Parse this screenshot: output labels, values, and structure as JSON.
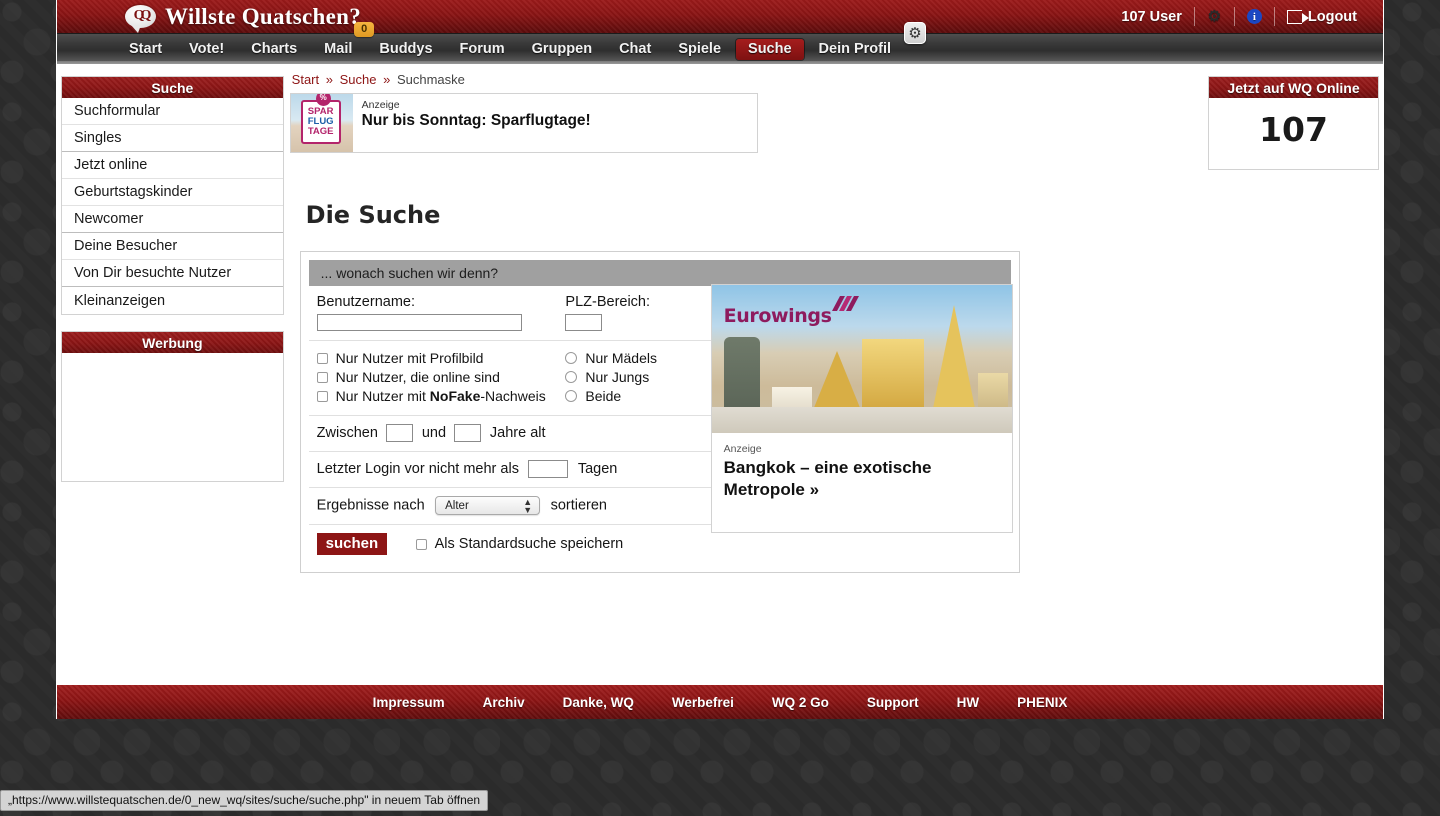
{
  "header": {
    "logo_text": "Willste Quatschen?",
    "logo_icon": "speech-bubble-icon",
    "user_count": "107 User",
    "gear_icon": "gear-icon",
    "info_icon": "info-icon",
    "logout_label": "Logout",
    "logout_icon": "logout-icon"
  },
  "nav": {
    "items": [
      {
        "label": "Start",
        "active": false
      },
      {
        "label": "Vote!",
        "active": false
      },
      {
        "label": "Charts",
        "active": false
      },
      {
        "label": "Mail",
        "active": false,
        "badge": "0"
      },
      {
        "label": "Buddys",
        "active": false
      },
      {
        "label": "Forum",
        "active": false
      },
      {
        "label": "Gruppen",
        "active": false
      },
      {
        "label": "Chat",
        "active": false
      },
      {
        "label": "Spiele",
        "active": false
      },
      {
        "label": "Suche",
        "active": true
      },
      {
        "label": "Dein Profil",
        "active": false
      }
    ],
    "mail_badge": "0",
    "profile_gear_icon": "gear-icon"
  },
  "sidebar": {
    "search_box": {
      "title": "Suche",
      "items": [
        "Suchformular",
        "Singles",
        "Jetzt online",
        "Geburtstagskinder",
        "Newcomer",
        "Deine Besucher",
        "Von Dir besuchte Nutzer",
        "Kleinanzeigen"
      ]
    },
    "ads_box": {
      "title": "Werbung"
    }
  },
  "breadcrumb": {
    "item1": "Start",
    "item2": "Suche",
    "item3": "Suchmaske",
    "separator": "»"
  },
  "top_ad": {
    "label": "Anzeige",
    "title": "Nur bis Sonntag: Sparflugtage!",
    "badge_line1": "SPAR",
    "badge_line2": "FLUG",
    "badge_line3": "TAGE"
  },
  "main": {
    "page_title": "Die Suche",
    "panel_header": "... wonach suchen wir denn?",
    "username_label": "Benutzername:",
    "username_value": "",
    "plz_label": "PLZ-Bereich:",
    "plz_value": "",
    "checkboxes": [
      {
        "label": "Nur Nutzer mit Profilbild",
        "checked": false
      },
      {
        "label": "Nur Nutzer, die online sind",
        "checked": false
      },
      {
        "label": "Nur Nutzer mit NoFake-Nachweis",
        "checked": false,
        "bold_part": "NoFake"
      }
    ],
    "radios": [
      {
        "label": "Nur Mädels",
        "checked": false
      },
      {
        "label": "Nur Jungs",
        "checked": false
      },
      {
        "label": "Beide",
        "checked": false
      }
    ],
    "age_prefix": "Zwischen",
    "age_middle": "und",
    "age_suffix": "Jahre alt",
    "age_from": "",
    "age_to": "",
    "login_prefix": "Letzter Login vor nicht mehr als",
    "login_suffix": "Tagen",
    "login_days": "",
    "sort_prefix": "Ergebnisse nach",
    "sort_suffix": "sortieren",
    "sort_selected": "Alter",
    "sort_options": [
      "Alter"
    ],
    "submit_label": "suchen",
    "save_default_label": "Als Standardsuche speichern",
    "save_default_checked": false
  },
  "side_ad": {
    "brand": "Eurowings",
    "label": "Anzeige",
    "title": "Bangkok – eine exotische Metropole »"
  },
  "right_sidebar": {
    "online_title": "Jetzt auf WQ Online",
    "online_count": "107"
  },
  "footer": {
    "links": [
      "Impressum",
      "Archiv",
      "Danke, WQ",
      "Werbefrei",
      "WQ 2 Go",
      "Support",
      "HW",
      "PHENIX"
    ]
  },
  "status_bar": {
    "text": "„https://www.willstequatschen.de/0_new_wq/sites/suche/suche.php\" in neuem Tab öffnen"
  },
  "colors": {
    "brand_red": "#8d1515",
    "header_dark_red": "#5c0c0c",
    "nav_gray": "#3a3a3a",
    "badge_orange": "#e09a22",
    "panel_header_gray": "#a0a0a0",
    "eurowings_magenta": "#8e1b5e"
  }
}
